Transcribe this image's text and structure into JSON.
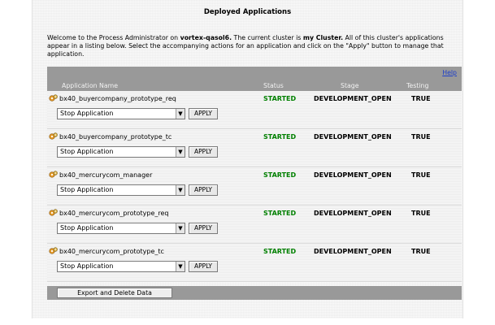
{
  "page": {
    "title": "Deployed Applications",
    "intro": {
      "part1": "Welcome to the Process Administrator on ",
      "host": "vortex-qasol6.",
      "part2": " The current cluster is ",
      "cluster": "my Cluster.",
      "part3": " All of this cluster's applications appear in a listing below. Select the accompanying actions for an application and click on the \"Apply\" button to manage that application."
    }
  },
  "table": {
    "help_link": "Help",
    "columns": {
      "name": "Application Name",
      "status": "Status",
      "stage": "Stage",
      "testing": "Testing"
    },
    "apply_label": "APPLY",
    "rows": [
      {
        "name": "bx40_buyercompany_prototype_req",
        "status": "STARTED",
        "stage": "DEVELOPMENT_OPEN",
        "testing": "TRUE",
        "action": "Stop Application"
      },
      {
        "name": "bx40_buyercompany_prototype_tc",
        "status": "STARTED",
        "stage": "DEVELOPMENT_OPEN",
        "testing": "TRUE",
        "action": "Stop Application"
      },
      {
        "name": "bx40_mercurycom_manager",
        "status": "STARTED",
        "stage": "DEVELOPMENT_OPEN",
        "testing": "TRUE",
        "action": "Stop Application"
      },
      {
        "name": "bx40_mercurycom_prototype_req",
        "status": "STARTED",
        "stage": "DEVELOPMENT_OPEN",
        "testing": "TRUE",
        "action": "Stop Application"
      },
      {
        "name": "bx40_mercurycom_prototype_tc",
        "status": "STARTED",
        "stage": "DEVELOPMENT_OPEN",
        "testing": "TRUE",
        "action": "Stop Application"
      }
    ],
    "footer": {
      "export_label": "Export and Delete Data"
    }
  },
  "icons": {
    "app_icon": "application-gears-icon",
    "dropdown": "chevron-down-icon"
  },
  "colors": {
    "header_bg": "#999999",
    "status_started": "#008000",
    "help_link": "#1d3fc9"
  }
}
